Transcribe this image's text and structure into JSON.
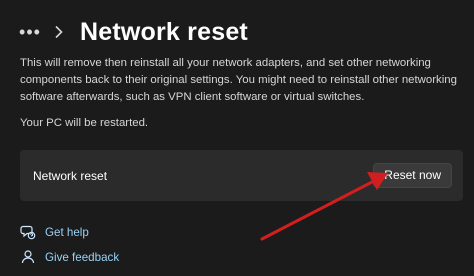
{
  "header": {
    "more_label": "•••",
    "title": "Network reset"
  },
  "main": {
    "description": "This will remove then reinstall all your network adapters, and set other networking components back to their original settings. You might need to reinstall other networking software afterwards, such as VPN client software or virtual switches.",
    "restart_note": "Your PC will be restarted.",
    "card": {
      "label": "Network reset",
      "button_label": "Reset now"
    }
  },
  "links": {
    "get_help": "Get help",
    "give_feedback": "Give feedback"
  },
  "colors": {
    "background": "#1b1b1b",
    "card": "#2b2b2b",
    "link": "#99d2f5",
    "annotation_arrow": "#d11f1f"
  },
  "icons": {
    "more": "more-horizontal-icon",
    "breadcrumb": "chevron-right-icon",
    "help": "help-icon",
    "feedback": "feedback-icon",
    "annotation": "red-arrow-annotation"
  }
}
